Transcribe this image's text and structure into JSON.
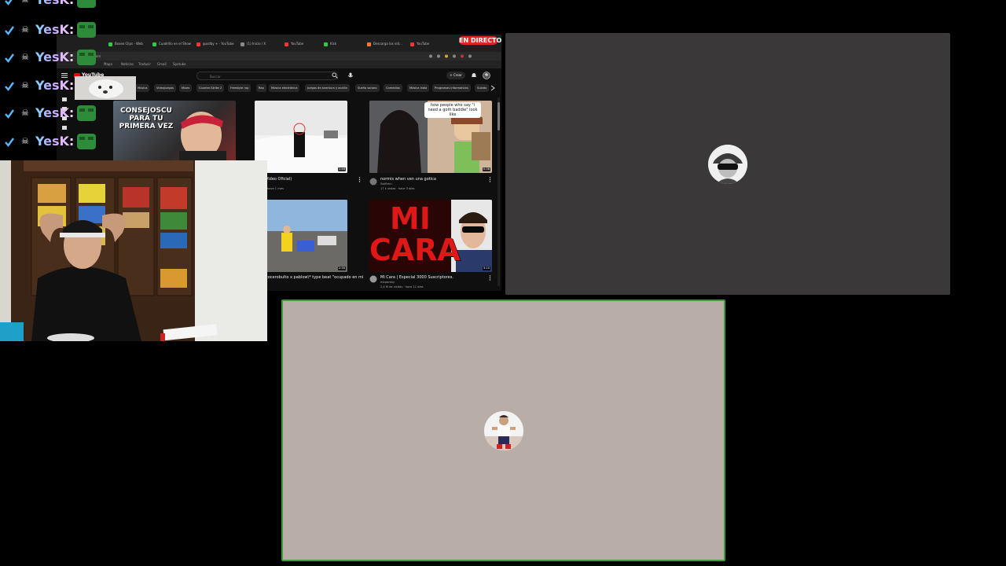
{
  "live_badge": "EN DIRECTO",
  "browser": {
    "tabs": [
      {
        "label": "Boxeo Clips - Web",
        "color": "#2ecc40"
      },
      {
        "label": "Cuadrillo en el Show",
        "color": "#2ecc40"
      },
      {
        "label": "gusdby + - YouTube",
        "color": "#ff3030"
      },
      {
        "label": "(1) Inicio / X",
        "color": "#888888"
      },
      {
        "label": "YouTube",
        "color": "#ff3030"
      },
      {
        "label": "Kick",
        "color": "#2ecc40"
      },
      {
        "label": "Descarga los vid...",
        "color": "#ff7a2a"
      },
      {
        "label": "YouTube",
        "color": "#ff3030"
      }
    ],
    "url": "youtube.com",
    "bookmarks": [
      "Mapa",
      "Noticias",
      "Traducir",
      "Gmail",
      "Spotube"
    ],
    "youtube": {
      "logo": "YouTube",
      "search_placeholder": "Buscar",
      "create_label": "+ Crear",
      "chips": [
        "Música",
        "Videojuegos",
        "Mixes",
        "Counter-Strike 2",
        "Freestyle rap",
        "Rap",
        "Música electrónica",
        "Juegos de aventura y acción",
        "Sueño sonoro",
        "Comedias",
        "Música india",
        "Programas informativos",
        "Subido"
      ],
      "videos": [
        {
          "overlay": "CONSEJOSCU PARA TU PRIMERA VEZ"
        },
        {
          "title": "(Video Oficial)",
          "meta": "hace 1 mes",
          "duration": "1:46"
        },
        {
          "overlay": "how people who say \"i need a goth baddie\" look like",
          "title": "normis when ven una gotica",
          "channel": "Swiftmn",
          "meta": "17 k vistas · hace 3 días",
          "duration": "0:38"
        },
        {
          "title": "cocerobulto x pablow\\* type beat \"ocupado en mi",
          "duration": "2:30"
        },
        {
          "overlay": "MI CARA",
          "title": "Mi Cara | Especial 3000 Suscriptores.",
          "channel": "mepersby",
          "meta": "2,4 M de visitas · hace 11 días",
          "duration": "3:10"
        }
      ]
    }
  },
  "chat": {
    "username": "YesK:",
    "rows": 6,
    "name_color": "#9fd4ff"
  },
  "colors": {
    "tile_top": "#3a3839",
    "tile_bottom": "#b9aea7",
    "speaking_border": "#3f9a3c",
    "live": "#e02323"
  }
}
